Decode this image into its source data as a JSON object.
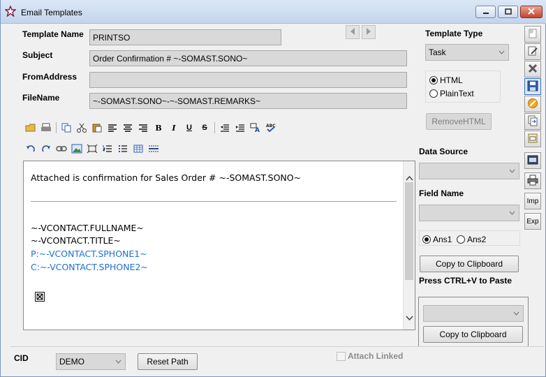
{
  "window": {
    "title": "Email Templates",
    "controls": [
      "minimize-icon",
      "maximize-icon",
      "close-icon"
    ]
  },
  "form": {
    "template_name_label": "Template Name",
    "template_name_value": "PRINTSO",
    "subject_label": "Subject",
    "subject_value": "Order Confirmation # ~-SOMAST.SONO~",
    "from_label": "FromAddress",
    "from_value": "",
    "filename_label": "FileName",
    "filename_value": "~-SOMAST.SONO~-~-SOMAST.REMARKS~"
  },
  "template_type": {
    "label": "Template Type",
    "selected": "Task",
    "format_options": [
      {
        "label": "HTML",
        "checked": true
      },
      {
        "label": "PlainText",
        "checked": false
      }
    ],
    "remove_html_label": "RemoveHTML"
  },
  "toolbar_row1": [
    "open-folder-icon",
    "print-icon",
    "copy-icon",
    "cut-icon",
    "paste-icon",
    "align-left-icon",
    "align-center-icon",
    "align-right-icon",
    "bold-icon",
    "italic-icon",
    "underline-icon",
    "strikethrough-icon",
    "outdent-icon",
    "indent-icon",
    "font-color-icon",
    "spellcheck-icon"
  ],
  "toolbar_row1_glyphs": {
    "bold": "B",
    "italic": "I",
    "underline": "U",
    "strike": "S"
  },
  "toolbar_row2": [
    "undo-icon",
    "redo-icon",
    "link-icon",
    "insert-image-icon",
    "insert-object-icon",
    "numbered-list-icon",
    "bullet-list-icon",
    "insert-table-icon",
    "horizontal-rule-icon"
  ],
  "editor": {
    "line1": "Attached is confirmation for Sales Order # ~-SOMAST.SONO~",
    "line2": "~-VCONTACT.FULLNAME~",
    "line3": "~-VCONTACT.TITLE~",
    "line4": "P:~-VCONTACT.SPHONE1~",
    "line5": "C:~-VCONTACT.SPHONE2~",
    "link_color": "#1e6fd0"
  },
  "data_source": {
    "label": "Data Source",
    "value": ""
  },
  "field_name": {
    "label": "Field Name",
    "value": "",
    "ans_options": [
      {
        "label": "Ans1",
        "checked": true
      },
      {
        "label": "Ans2",
        "checked": false
      }
    ],
    "copy_label": "Copy to Clipboard",
    "paste_hint": "Press CTRL+V to Paste"
  },
  "paste_group": {
    "value": "",
    "copy_label": "Copy to Clipboard"
  },
  "side_buttons": [
    "new-doc-icon",
    "edit-doc-icon",
    "delete-icon",
    "save-icon",
    "cancel-icon",
    "copy-doc-icon",
    "print-preview-icon",
    "email-icon",
    "printer-icon"
  ],
  "side_text_buttons": {
    "imp": "Imp",
    "exp": "Exp"
  },
  "footer": {
    "cid_label": "CID",
    "cid_value": "DEMO",
    "reset_path_label": "Reset Path",
    "attach_linked_label": "Attach Linked",
    "attach_linked_checked": false
  }
}
